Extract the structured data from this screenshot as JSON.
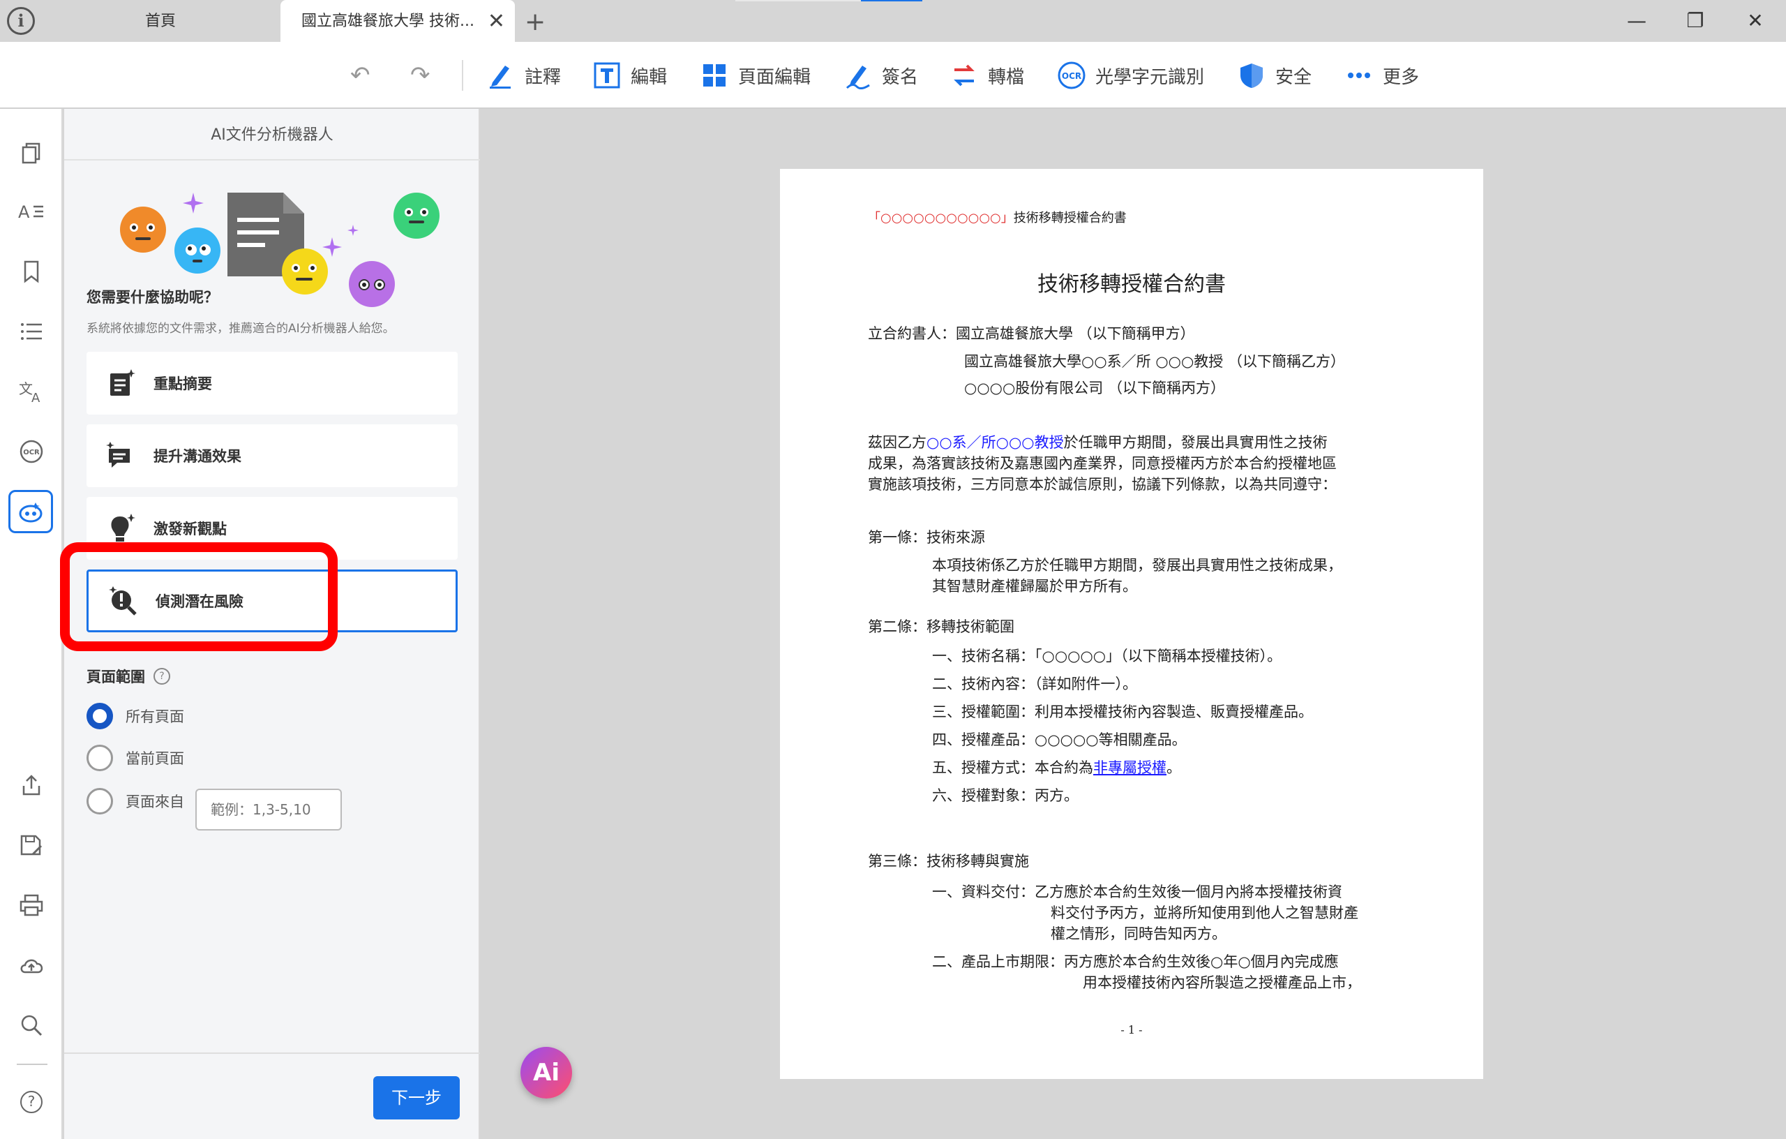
{
  "tabs": {
    "home": "首頁",
    "doc": "國立高雄餐旅大學 技術...",
    "close": "✕",
    "add": "+"
  },
  "window": {
    "minimize": "—",
    "restore": "❐",
    "close": "✕"
  },
  "toolbar": {
    "undo": "↶",
    "redo": "↷",
    "items": [
      {
        "label": "註釋",
        "icon": "pen-icon"
      },
      {
        "label": "編輯",
        "icon": "text-edit-icon"
      },
      {
        "label": "頁面編輯",
        "icon": "grid-icon"
      },
      {
        "label": "簽名",
        "icon": "signature-icon"
      },
      {
        "label": "轉檔",
        "icon": "convert-icon"
      },
      {
        "label": "光學字元識別",
        "icon": "ocr-icon"
      },
      {
        "label": "安全",
        "icon": "shield-icon"
      },
      {
        "label": "更多",
        "icon": "more-icon"
      }
    ]
  },
  "rail": {
    "icons": [
      "pages-icon",
      "text-format-icon",
      "bookmark-icon",
      "list-icon",
      "translate-icon",
      "ocr-icon",
      "ai-bot-icon",
      "share-icon",
      "save-icon",
      "print-icon",
      "cloud-upload-icon",
      "search-icon",
      "help-icon"
    ],
    "help": "?"
  },
  "panel": {
    "title": "AI文件分析機器人",
    "question": "您需要什麼協助呢？",
    "subtitle": "系統將依據您的文件需求，推薦適合的AI分析機器人給您。",
    "options": [
      {
        "label": "重點摘要",
        "icon": "summary-icon"
      },
      {
        "label": "提升溝通效果",
        "icon": "chat-icon"
      },
      {
        "label": "激發新觀點",
        "icon": "lightbulb-icon"
      },
      {
        "label": "偵測潛在風險",
        "icon": "risk-search-icon"
      }
    ],
    "range_label": "頁面範圍",
    "range_help": "?",
    "range_options": [
      "所有頁面",
      "當前頁面",
      "頁面來自"
    ],
    "range_selected": "所有頁面",
    "range_placeholder": "範例：1,3-5,10",
    "next": "下一步"
  },
  "ai_fab": "Ai",
  "document": {
    "header_quoted": "「○○○○○○○○○○○」",
    "header_rest": "技術移轉授權合約書",
    "title": "技術移轉授權合約書",
    "parties": [
      "立合約書人：國立高雄餐旅大學 （以下簡稱甲方）",
      "國立高雄餐旅大學○○系／所 ○○○教授 （以下簡稱乙方）",
      "○○○○股份有限公司 （以下簡稱丙方）"
    ],
    "intro_pre": "茲因乙方",
    "intro_highlight": "○○系／所○○○教授",
    "intro_post": "於任職甲方期間，發展出具實用性之技術",
    "intro_lines": [
      "成果，為落實該技術及嘉惠國內產業界，同意授權丙方於本合約授權地區",
      "實施該項技術，三方同意本於誠信原則，協議下列條款，以為共同遵守："
    ],
    "art1_title": "第一條：技術來源",
    "art1_lines": [
      "本項技術係乙方於任職甲方期間，發展出具實用性之技術成果，",
      "其智慧財產權歸屬於甲方所有。"
    ],
    "art2_title": "第二條：移轉技術範圍",
    "art2_items": [
      "一、技術名稱：「○○○○○」（以下簡稱本授權技術）。",
      "二、技術內容：（詳如附件一）。",
      "三、授權範圍：利用本授權技術內容製造、販賣授權產品。",
      "四、授權產品：○○○○○等相關產品。"
    ],
    "art2_item5_pre": "五、授權方式：本合約為",
    "art2_item5_link": "非專屬授權",
    "art2_item5_post": "。",
    "art2_item6": "六、授權對象：丙方。",
    "art3_title": "第三條：技術移轉與實施",
    "art3_item1": [
      "一、資料交付：乙方應於本合約生效後一個月內將本授權技術資",
      "料交付予丙方，並將所知使用到他人之智慧財產",
      "權之情形，同時告知丙方。"
    ],
    "art3_item2": [
      "二、產品上市期限：丙方應於本合約生效後○年○個月內完成應",
      "用本授權技術內容所製造之授權產品上市，"
    ],
    "page_number": "- 1 -"
  }
}
